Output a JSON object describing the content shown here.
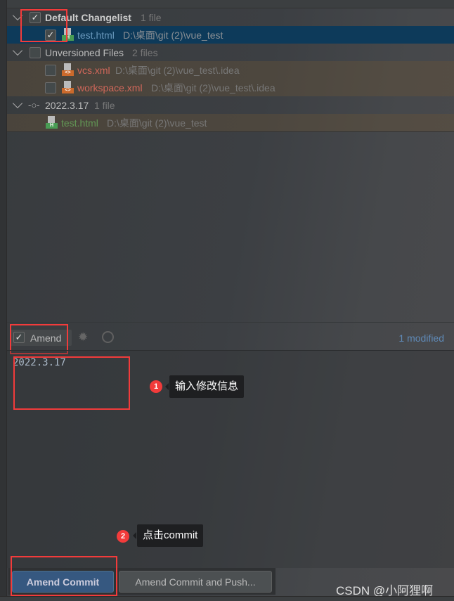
{
  "changes": {
    "default_changelist": {
      "name": "Default Changelist",
      "count": "1 file",
      "checked": true,
      "files": [
        {
          "name": "test.html",
          "path": "D:\\桌面\\git (2)\\vue_test",
          "checked": true,
          "type": "H"
        }
      ]
    },
    "unversioned": {
      "name": "Unversioned Files",
      "count": "2 files",
      "checked": false,
      "files": [
        {
          "name": "vcs.xml",
          "path": "D:\\桌面\\git (2)\\vue_test\\.idea",
          "checked": false,
          "type": "<>"
        },
        {
          "name": "workspace.xml",
          "path": "D:\\桌面\\git (2)\\vue_test\\.idea",
          "checked": false,
          "type": "<>"
        }
      ]
    },
    "commit_node": {
      "name": "2022.3.17",
      "count": "1 file",
      "files": [
        {
          "name": "test.html",
          "path": "D:\\桌面\\git (2)\\vue_test",
          "type": "H"
        }
      ]
    }
  },
  "commit_toolbar": {
    "amend_label": "Amend",
    "amend_checked": true,
    "modified": "1 modified",
    "icons": [
      "gear-icon",
      "clock-icon"
    ]
  },
  "message": "2022.3.17",
  "annotations": [
    {
      "num": "1",
      "text": "输入修改信息"
    },
    {
      "num": "2",
      "text": "点击commit"
    }
  ],
  "buttons": {
    "amend_commit": "Amend Commit",
    "amend_commit_push": "Amend Commit and Push..."
  },
  "watermark": "CSDN @小阿狸啊",
  "colors": {
    "selected_row": "#0d3a5a",
    "primary_button": "#365880",
    "annotation_red": "#f23b3b",
    "added_file": "#629755",
    "unversioned_file": "#d1675a",
    "modified_file": "#6897bb"
  }
}
